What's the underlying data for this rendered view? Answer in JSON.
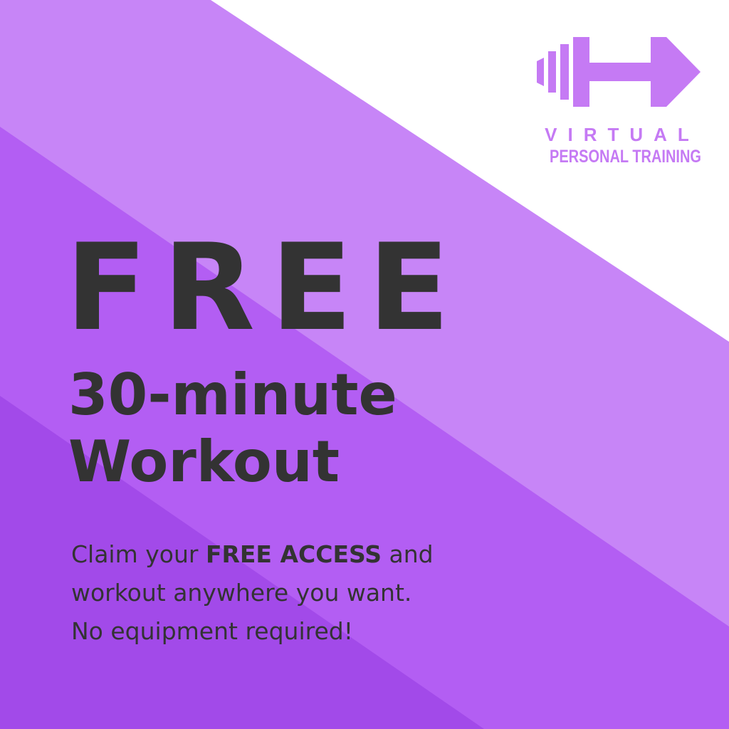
{
  "colors": {
    "background": "#ffffff",
    "band_light": "#c785f7",
    "band_medium": "#b35ef3",
    "band_dark": "#a24ae9",
    "accent": "#c57af4",
    "text_dark": "#333333"
  },
  "logo": {
    "icon": "dumbbell-play-icon",
    "line1": "VIRTUAL",
    "line2": "PERSONAL TRAINING"
  },
  "headline": "FREE",
  "subheadline": {
    "line1": "30-minute",
    "line2": "Workout"
  },
  "body": {
    "line1_prefix": "Claim your ",
    "line1_bold": "FREE ACCESS",
    "line1_suffix": " and",
    "line2": "workout anywhere you want.",
    "line3": "No equipment required!"
  }
}
